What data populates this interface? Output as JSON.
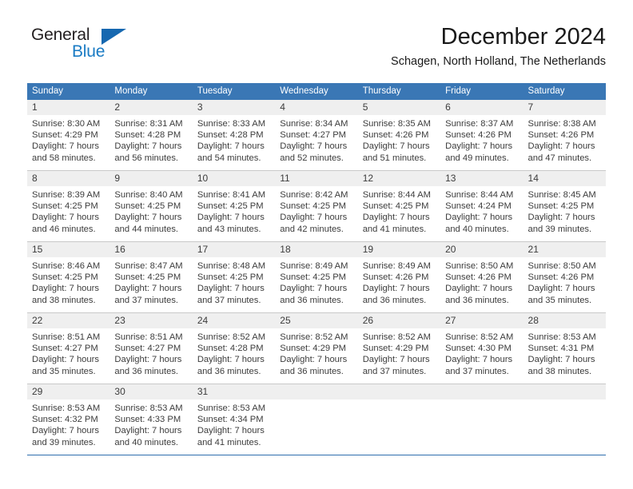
{
  "brand": {
    "name_part1": "General",
    "name_part2": "Blue",
    "triangle_icon": "triangle-logo-icon",
    "color_dark": "#231f20",
    "color_blue": "#1a7bc4"
  },
  "header": {
    "title": "December 2024",
    "subtitle": "Schagen, North Holland, The Netherlands"
  },
  "theme": {
    "header_row_bg": "#3a77b5",
    "day_number_bg": "#efefef",
    "grid_line": "#c9c9c9",
    "last_row_line": "#2f6fae",
    "text": "#3c3c3c"
  },
  "weekdays": [
    "Sunday",
    "Monday",
    "Tuesday",
    "Wednesday",
    "Thursday",
    "Friday",
    "Saturday"
  ],
  "weeks": [
    [
      {
        "day": "1",
        "sunrise": "Sunrise: 8:30 AM",
        "sunset": "Sunset: 4:29 PM",
        "daylight1": "Daylight: 7 hours",
        "daylight2": "and 58 minutes."
      },
      {
        "day": "2",
        "sunrise": "Sunrise: 8:31 AM",
        "sunset": "Sunset: 4:28 PM",
        "daylight1": "Daylight: 7 hours",
        "daylight2": "and 56 minutes."
      },
      {
        "day": "3",
        "sunrise": "Sunrise: 8:33 AM",
        "sunset": "Sunset: 4:28 PM",
        "daylight1": "Daylight: 7 hours",
        "daylight2": "and 54 minutes."
      },
      {
        "day": "4",
        "sunrise": "Sunrise: 8:34 AM",
        "sunset": "Sunset: 4:27 PM",
        "daylight1": "Daylight: 7 hours",
        "daylight2": "and 52 minutes."
      },
      {
        "day": "5",
        "sunrise": "Sunrise: 8:35 AM",
        "sunset": "Sunset: 4:26 PM",
        "daylight1": "Daylight: 7 hours",
        "daylight2": "and 51 minutes."
      },
      {
        "day": "6",
        "sunrise": "Sunrise: 8:37 AM",
        "sunset": "Sunset: 4:26 PM",
        "daylight1": "Daylight: 7 hours",
        "daylight2": "and 49 minutes."
      },
      {
        "day": "7",
        "sunrise": "Sunrise: 8:38 AM",
        "sunset": "Sunset: 4:26 PM",
        "daylight1": "Daylight: 7 hours",
        "daylight2": "and 47 minutes."
      }
    ],
    [
      {
        "day": "8",
        "sunrise": "Sunrise: 8:39 AM",
        "sunset": "Sunset: 4:25 PM",
        "daylight1": "Daylight: 7 hours",
        "daylight2": "and 46 minutes."
      },
      {
        "day": "9",
        "sunrise": "Sunrise: 8:40 AM",
        "sunset": "Sunset: 4:25 PM",
        "daylight1": "Daylight: 7 hours",
        "daylight2": "and 44 minutes."
      },
      {
        "day": "10",
        "sunrise": "Sunrise: 8:41 AM",
        "sunset": "Sunset: 4:25 PM",
        "daylight1": "Daylight: 7 hours",
        "daylight2": "and 43 minutes."
      },
      {
        "day": "11",
        "sunrise": "Sunrise: 8:42 AM",
        "sunset": "Sunset: 4:25 PM",
        "daylight1": "Daylight: 7 hours",
        "daylight2": "and 42 minutes."
      },
      {
        "day": "12",
        "sunrise": "Sunrise: 8:44 AM",
        "sunset": "Sunset: 4:25 PM",
        "daylight1": "Daylight: 7 hours",
        "daylight2": "and 41 minutes."
      },
      {
        "day": "13",
        "sunrise": "Sunrise: 8:44 AM",
        "sunset": "Sunset: 4:24 PM",
        "daylight1": "Daylight: 7 hours",
        "daylight2": "and 40 minutes."
      },
      {
        "day": "14",
        "sunrise": "Sunrise: 8:45 AM",
        "sunset": "Sunset: 4:25 PM",
        "daylight1": "Daylight: 7 hours",
        "daylight2": "and 39 minutes."
      }
    ],
    [
      {
        "day": "15",
        "sunrise": "Sunrise: 8:46 AM",
        "sunset": "Sunset: 4:25 PM",
        "daylight1": "Daylight: 7 hours",
        "daylight2": "and 38 minutes."
      },
      {
        "day": "16",
        "sunrise": "Sunrise: 8:47 AM",
        "sunset": "Sunset: 4:25 PM",
        "daylight1": "Daylight: 7 hours",
        "daylight2": "and 37 minutes."
      },
      {
        "day": "17",
        "sunrise": "Sunrise: 8:48 AM",
        "sunset": "Sunset: 4:25 PM",
        "daylight1": "Daylight: 7 hours",
        "daylight2": "and 37 minutes."
      },
      {
        "day": "18",
        "sunrise": "Sunrise: 8:49 AM",
        "sunset": "Sunset: 4:25 PM",
        "daylight1": "Daylight: 7 hours",
        "daylight2": "and 36 minutes."
      },
      {
        "day": "19",
        "sunrise": "Sunrise: 8:49 AM",
        "sunset": "Sunset: 4:26 PM",
        "daylight1": "Daylight: 7 hours",
        "daylight2": "and 36 minutes."
      },
      {
        "day": "20",
        "sunrise": "Sunrise: 8:50 AM",
        "sunset": "Sunset: 4:26 PM",
        "daylight1": "Daylight: 7 hours",
        "daylight2": "and 36 minutes."
      },
      {
        "day": "21",
        "sunrise": "Sunrise: 8:50 AM",
        "sunset": "Sunset: 4:26 PM",
        "daylight1": "Daylight: 7 hours",
        "daylight2": "and 35 minutes."
      }
    ],
    [
      {
        "day": "22",
        "sunrise": "Sunrise: 8:51 AM",
        "sunset": "Sunset: 4:27 PM",
        "daylight1": "Daylight: 7 hours",
        "daylight2": "and 35 minutes."
      },
      {
        "day": "23",
        "sunrise": "Sunrise: 8:51 AM",
        "sunset": "Sunset: 4:27 PM",
        "daylight1": "Daylight: 7 hours",
        "daylight2": "and 36 minutes."
      },
      {
        "day": "24",
        "sunrise": "Sunrise: 8:52 AM",
        "sunset": "Sunset: 4:28 PM",
        "daylight1": "Daylight: 7 hours",
        "daylight2": "and 36 minutes."
      },
      {
        "day": "25",
        "sunrise": "Sunrise: 8:52 AM",
        "sunset": "Sunset: 4:29 PM",
        "daylight1": "Daylight: 7 hours",
        "daylight2": "and 36 minutes."
      },
      {
        "day": "26",
        "sunrise": "Sunrise: 8:52 AM",
        "sunset": "Sunset: 4:29 PM",
        "daylight1": "Daylight: 7 hours",
        "daylight2": "and 37 minutes."
      },
      {
        "day": "27",
        "sunrise": "Sunrise: 8:52 AM",
        "sunset": "Sunset: 4:30 PM",
        "daylight1": "Daylight: 7 hours",
        "daylight2": "and 37 minutes."
      },
      {
        "day": "28",
        "sunrise": "Sunrise: 8:53 AM",
        "sunset": "Sunset: 4:31 PM",
        "daylight1": "Daylight: 7 hours",
        "daylight2": "and 38 minutes."
      }
    ],
    [
      {
        "day": "29",
        "sunrise": "Sunrise: 8:53 AM",
        "sunset": "Sunset: 4:32 PM",
        "daylight1": "Daylight: 7 hours",
        "daylight2": "and 39 minutes."
      },
      {
        "day": "30",
        "sunrise": "Sunrise: 8:53 AM",
        "sunset": "Sunset: 4:33 PM",
        "daylight1": "Daylight: 7 hours",
        "daylight2": "and 40 minutes."
      },
      {
        "day": "31",
        "sunrise": "Sunrise: 8:53 AM",
        "sunset": "Sunset: 4:34 PM",
        "daylight1": "Daylight: 7 hours",
        "daylight2": "and 41 minutes."
      },
      {
        "day": "",
        "sunrise": "",
        "sunset": "",
        "daylight1": "",
        "daylight2": ""
      },
      {
        "day": "",
        "sunrise": "",
        "sunset": "",
        "daylight1": "",
        "daylight2": ""
      },
      {
        "day": "",
        "sunrise": "",
        "sunset": "",
        "daylight1": "",
        "daylight2": ""
      },
      {
        "day": "",
        "sunrise": "",
        "sunset": "",
        "daylight1": "",
        "daylight2": ""
      }
    ]
  ]
}
